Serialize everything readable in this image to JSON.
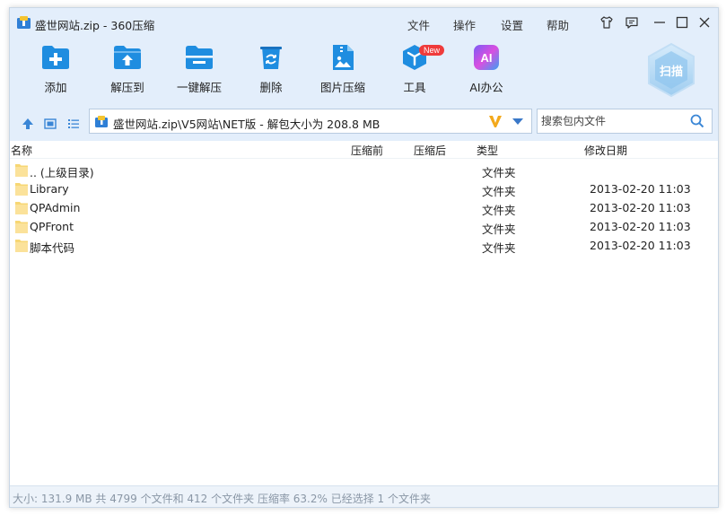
{
  "window": {
    "title": "盛世网站.zip - 360压缩",
    "menus": [
      "文件",
      "操作",
      "设置",
      "帮助"
    ],
    "title_icons": [
      "shirt-icon",
      "message-icon",
      "minimize-icon",
      "maximize-icon",
      "close-icon"
    ]
  },
  "toolbar": {
    "items": [
      {
        "label": "添加",
        "icon": "add-icon"
      },
      {
        "label": "解压到",
        "icon": "extract-to-icon"
      },
      {
        "label": "一键解压",
        "icon": "one-click-extract-icon"
      },
      {
        "label": "删除",
        "icon": "delete-icon"
      },
      {
        "label": "图片压缩",
        "icon": "image-compress-icon"
      },
      {
        "label": "工具",
        "icon": "tools-icon",
        "badge": "New"
      },
      {
        "label": "AI办公",
        "icon": "ai-office-icon",
        "icon_text": "AI"
      }
    ],
    "scan_label": "扫描"
  },
  "address": {
    "path": "盛世网站.zip\\V5网站\\NET版 - 解包大小为 208.8 MB",
    "search_placeholder": "搜索包内文件"
  },
  "columns": [
    "名称",
    "压缩前",
    "压缩后",
    "类型",
    "修改日期"
  ],
  "files": [
    {
      "name": ".. (上级目录)",
      "type": "文件夹",
      "date": ""
    },
    {
      "name": "Library",
      "type": "文件夹",
      "date": "2013-02-20 11:03"
    },
    {
      "name": "QPAdmin",
      "type": "文件夹",
      "date": "2013-02-20 11:03"
    },
    {
      "name": "QPFront",
      "type": "文件夹",
      "date": "2013-02-20 11:03"
    },
    {
      "name": "脚本代码",
      "type": "文件夹",
      "date": "2013-02-20 11:03"
    }
  ],
  "status": "大小: 131.9 MB 共 4799 个文件和 412 个文件夹 压缩率 63.2% 已经选择 1 个文件夹",
  "colors": {
    "accent": "#1f8de0",
    "chrome_bg": "#e3eefb",
    "folder": "#f7d774",
    "status_text": "#8a97a6"
  }
}
